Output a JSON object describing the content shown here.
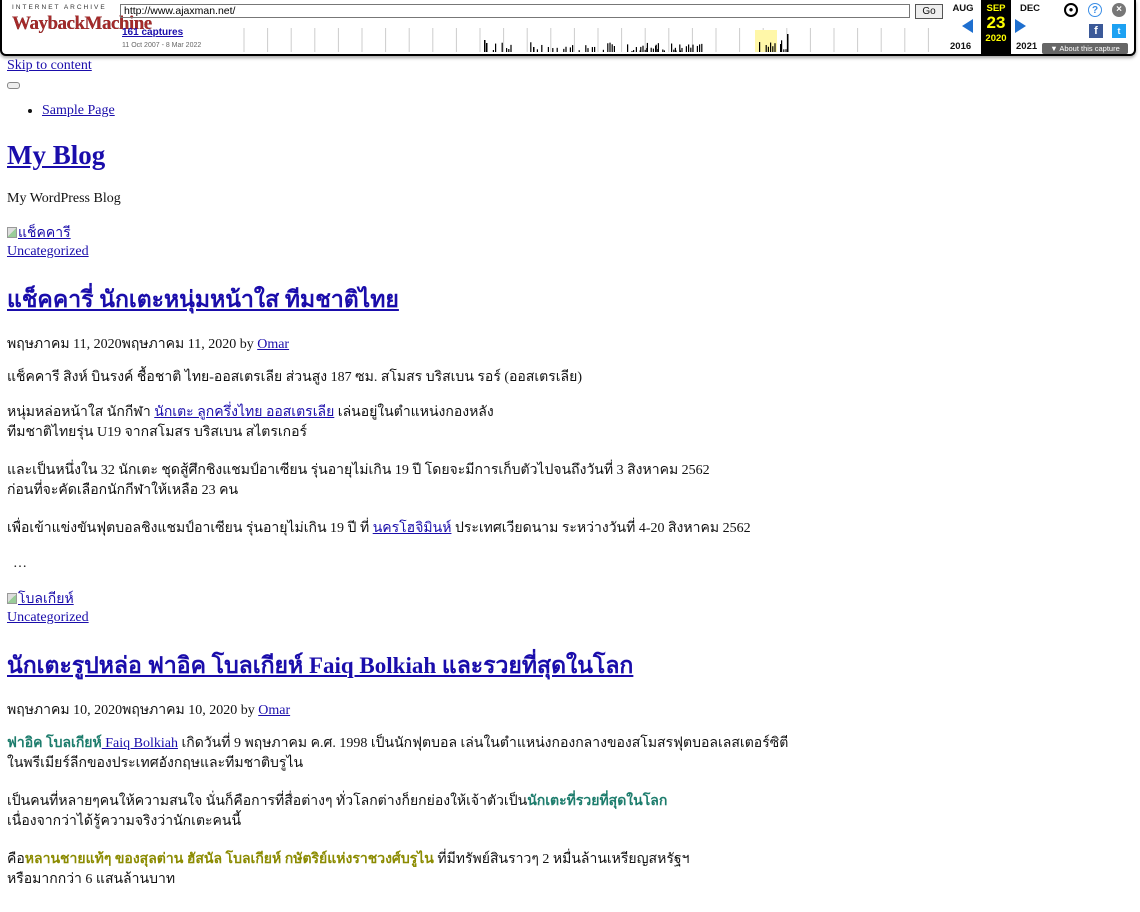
{
  "wayback": {
    "ia_label": "INTERNET ARCHIVE",
    "logo_text": "WaybackMachine",
    "url": "http://www.ajaxman.net/",
    "go_label": "Go",
    "captures": "161 captures",
    "date_range": "11 Oct 2007 - 8 Mar 2022",
    "prev_month": "AUG",
    "cur_month": "SEP",
    "next_month": "DEC",
    "cur_day": "23",
    "prev_year": "2016",
    "cur_year": "2020",
    "next_year": "2021",
    "about_label": "About this capture",
    "icons": [
      "user-icon",
      "help-icon",
      "close-icon",
      "facebook-icon",
      "twitter-icon",
      "prev-arrow-icon",
      "next-arrow-icon"
    ]
  },
  "page": {
    "skip_link": "Skip to content",
    "nav": [
      "Sample Page"
    ],
    "site_title": "My Blog",
    "site_desc": "My WordPress Blog"
  },
  "posts": [
    {
      "thumb_alt": "แช็คคารี",
      "category": "Uncategorized",
      "title": "แช็คคารี่ นักเตะหนุ่มหน้าใส ทีมชาติไทย",
      "meta_date": "พฤษภาคม 11, 2020พฤษภาคม 11, 2020 by ",
      "author": "Omar",
      "p1": "แช็คคารี สิงห์ บินรงค์ ชื้อชาติ ไทย-ออสเตรเลีย ส่วนสูง 187 ซม. สโมสร บริสเบน รอร์ (ออสเตรเลีย)",
      "p2_a": "หนุ่มหล่อหน้าใส นักกีฬา ",
      "p2_link": "นักเตะ ลูกครึ่งไทย ออสเตรเลีย",
      "p2_b": " เล่นอยู่ในตำแหน่งกองหลัง",
      "p2_c": "ทีมชาติไทยรุ่น U19 จากสโมสร บริสเบน สไตรเกอร์",
      "p3_a": "และเป็นหนึ่งใน 32 นักเตะ ชุดสู้ศึกชิงแชมป์อาเซียน รุ่นอายุไม่เกิน 19 ปี โดยจะมีการเก็บตัวไปจนถึงวันที่ 3 สิงหาคม 2562",
      "p3_b": "ก่อนที่จะคัดเลือกนักกีฬาให้เหลือ 23 คน",
      "p4_a": "เพื่อเข้าแข่งขันฟุตบอลชิงแชมป์อาเซียน รุ่นอายุไม่เกิน 19 ปี ที่ ",
      "p4_link": "นครโฮจิมินห์",
      "p4_b": " ประเทศเวียดนาม ระหว่างวันที่ 4-20 สิงหาคม 2562",
      "ellipsis": "…"
    },
    {
      "thumb_alt": "โบลเกียห์",
      "category": "Uncategorized",
      "title": "นักเตะรูปหล่อ ฟาอิค โบลเกียห์ Faiq Bolkiah และรวยที่สุดในโลก",
      "meta_date": "พฤษภาคม 10, 2020พฤษภาคม 10, 2020 by ",
      "author": "Omar",
      "p1_green": "ฟาอิค โบลเกียห์",
      "p1_link": " Faiq Bolkiah",
      "p1_a": " เกิดวันที่ 9 พฤษภาคม ค.ศ. 1998 เป็นนักฟุตบอล เล่นในตำแหน่งกองกลางของสโมสรฟุตบอลเลสเตอร์ซิตี",
      "p1_b": "ในพรีเมียร์ลีกของประเทศอังกฤษและทีมชาติบรูไน",
      "p2_a": "เป็นคนที่หลายๆคนให้ความสนใจ นั่นก็คือการที่สื่อต่างๆ ทั่วโลกต่างก็ยกย่องให้เจ้าตัวเป็น",
      "p2_green": "นักเตะที่รวยที่สุดในโลก",
      "p2_b": "เนื่องจากว่าได้รู้ความจริงว่านักเตะคนนี้",
      "p3_a": "คือ",
      "p3_olive": "หลานชายแท้ๆ ของสุลต่าน ฮัสนัล โบลเกียห์ กษัตริย์แห่งราชวงศ์บรูไน",
      "p3_b": " ที่มีทรัพย์สินราวๆ 2 หมื่นล้านเหรียญสหรัฐฯ",
      "p3_c": "หรือมากกว่า 6 แสนล้านบาท"
    }
  ]
}
